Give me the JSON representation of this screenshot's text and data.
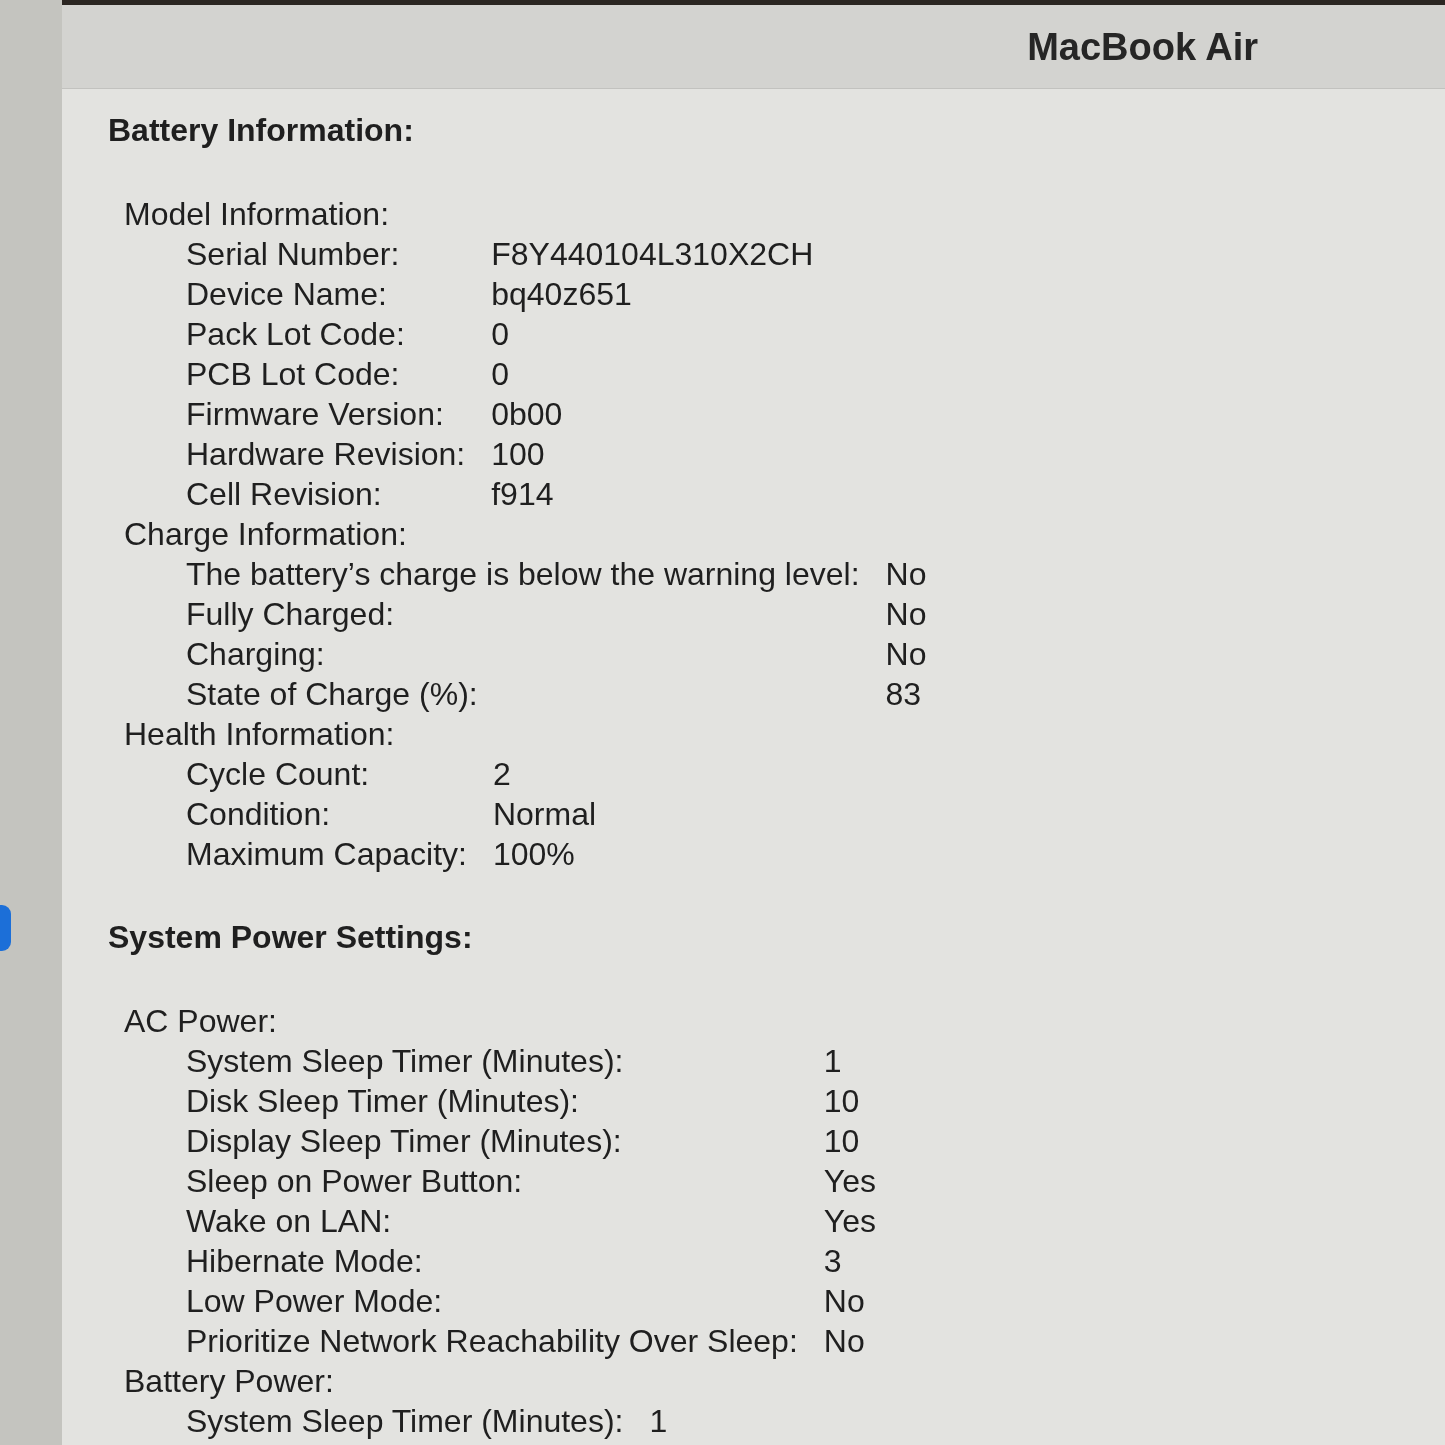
{
  "window": {
    "title": "MacBook Air"
  },
  "sections": [
    {
      "heading": "Battery Information:",
      "groups": [
        {
          "heading": "Model Information:",
          "rows": [
            {
              "label": "Serial Number:",
              "value": "F8Y440104L310X2CH"
            },
            {
              "label": "Device Name:",
              "value": "bq40z651"
            },
            {
              "label": "Pack Lot Code:",
              "value": "0"
            },
            {
              "label": "PCB Lot Code:",
              "value": "0"
            },
            {
              "label": "Firmware Version:",
              "value": "0b00"
            },
            {
              "label": "Hardware Revision:",
              "value": "100"
            },
            {
              "label": "Cell Revision:",
              "value": "f914"
            }
          ]
        },
        {
          "heading": "Charge Information:",
          "rows": [
            {
              "label": "The battery’s charge is below the warning level:",
              "value": "No"
            },
            {
              "label": "Fully Charged:",
              "value": "No"
            },
            {
              "label": "Charging:",
              "value": "No"
            },
            {
              "label": "State of Charge (%):",
              "value": "83"
            }
          ]
        },
        {
          "heading": "Health Information:",
          "rows": [
            {
              "label": "Cycle Count:",
              "value": "2"
            },
            {
              "label": "Condition:",
              "value": "Normal"
            },
            {
              "label": "Maximum Capacity:",
              "value": "100%"
            }
          ]
        }
      ]
    },
    {
      "heading": "System Power Settings:",
      "groups": [
        {
          "heading": "AC Power:",
          "rows": [
            {
              "label": "System Sleep Timer (Minutes):",
              "value": "1"
            },
            {
              "label": "Disk Sleep Timer (Minutes):",
              "value": "10"
            },
            {
              "label": "Display Sleep Timer (Minutes):",
              "value": "10"
            },
            {
              "label": "Sleep on Power Button:",
              "value": "Yes"
            },
            {
              "label": "Wake on LAN:",
              "value": "Yes"
            },
            {
              "label": "Hibernate Mode:",
              "value": "3"
            },
            {
              "label": "Low Power Mode:",
              "value": "No"
            },
            {
              "label": "Prioritize Network Reachability Over Sleep:",
              "value": "No"
            }
          ]
        },
        {
          "heading": "Battery Power:",
          "rows": [
            {
              "label": "System Sleep Timer (Minutes):",
              "value": "1"
            }
          ]
        }
      ]
    }
  ]
}
